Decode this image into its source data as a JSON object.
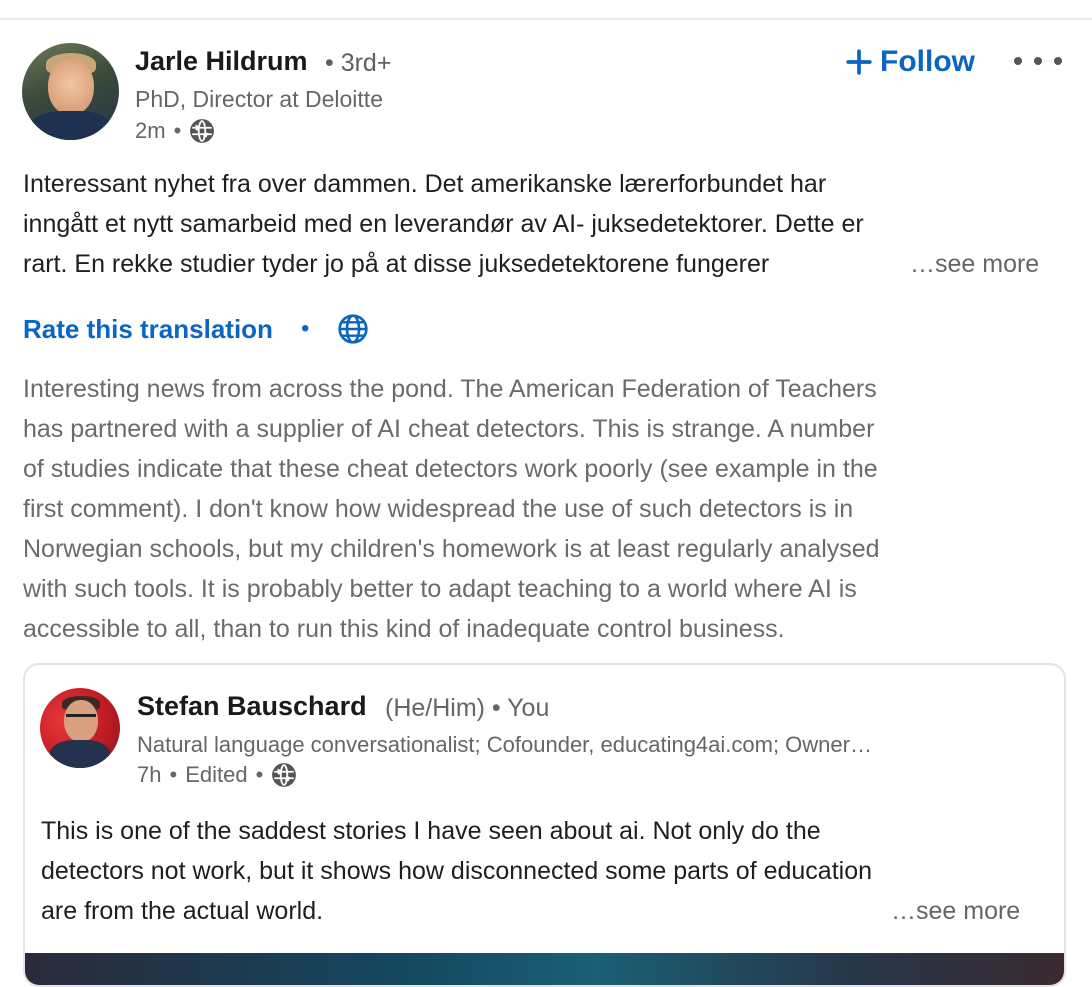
{
  "post": {
    "author": {
      "name": "Jarle Hildrum",
      "degree": "• 3rd+",
      "headline": "PhD, Director at Deloitte",
      "time": "2m",
      "visibility_icon": "globe-icon"
    },
    "follow_label": "Follow",
    "text_lines": [
      "Interessant nyhet fra over dammen. Det amerikanske lærerforbundet har",
      "inngått et nytt samarbeid med en leverandør av AI- juksedetektorer. Dette er",
      "rart. En rekke studier tyder jo på at disse juksedetektorene fungerer"
    ],
    "see_more": "…see more",
    "rate_translation": "Rate this translation",
    "translated_lines": [
      "Interesting news from across the pond. The American Federation of Teachers",
      "has partnered with a supplier of AI cheat detectors. This is strange. A number",
      "of studies indicate that these cheat detectors work poorly (see example in the",
      "first comment). I don't know how widespread the use of such detectors is in",
      "Norwegian schools, but my children's homework is at least regularly analysed",
      "with such tools. It is probably better to adapt teaching to a world where AI is",
      "accessible to all, than to run this kind of inadequate control business."
    ]
  },
  "reshared": {
    "author": {
      "name": "Stefan Bauschard",
      "pronouns": "(He/Him) • You",
      "headline": "Natural language conversationalist; Cofounder, educating4ai.com; Owner…",
      "time": "7h",
      "edited": "Edited"
    },
    "text_lines": [
      "This is one of the saddest stories I have seen about ai. Not only do the",
      "detectors not work, but it shows how disconnected some parts of education",
      "are from the actual world."
    ],
    "see_more": "…see more"
  },
  "colors": {
    "link_blue": "#0a66c2",
    "secondary_text": "#666666",
    "translated_text": "#6b6b6b"
  }
}
